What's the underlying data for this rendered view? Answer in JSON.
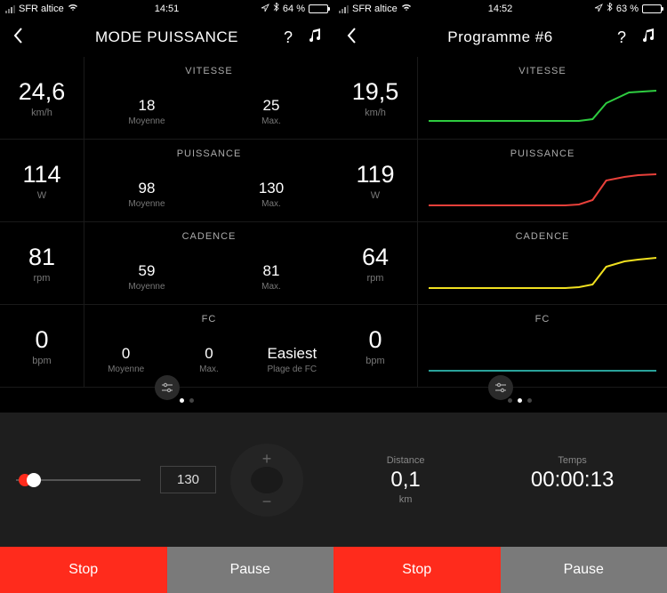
{
  "colors": {
    "stop": "#ff2b1c",
    "pause": "#7a7a7a",
    "vitesse": "#2ecc40",
    "puissance": "#e8403a",
    "cadence": "#f0e020",
    "fc": "#2aa39a"
  },
  "left": {
    "status": {
      "carrier": "SFR altice",
      "time": "14:51",
      "battery_pct": "64 %",
      "battery_fill": 64
    },
    "title": "MODE PUISSANCE",
    "metrics": {
      "vitesse": {
        "label": "VITESSE",
        "value": "24,6",
        "unit": "km/h",
        "moy": "18",
        "moy_l": "Moyenne",
        "max": "25",
        "max_l": "Max."
      },
      "puissance": {
        "label": "PUISSANCE",
        "value": "114",
        "unit": "W",
        "moy": "98",
        "moy_l": "Moyenne",
        "max": "130",
        "max_l": "Max."
      },
      "cadence": {
        "label": "CADENCE",
        "value": "81",
        "unit": "rpm",
        "moy": "59",
        "moy_l": "Moyenne",
        "max": "81",
        "max_l": "Max."
      },
      "fc": {
        "label": "FC",
        "value": "0",
        "unit": "bpm",
        "moy": "0",
        "moy_l": "Moyenne",
        "max": "0",
        "max_l": "Max.",
        "extra": "Easiest",
        "extra_l": "Plage de FC"
      }
    },
    "pager": {
      "active": 0,
      "count": 2
    },
    "control": {
      "value": "130",
      "plus": "+",
      "minus": "−"
    },
    "footer": {
      "stop": "Stop",
      "pause": "Pause"
    }
  },
  "right": {
    "status": {
      "carrier": "SFR altice",
      "time": "14:52",
      "battery_pct": "63 %",
      "battery_fill": 63
    },
    "title": "Programme #6",
    "metrics": {
      "vitesse": {
        "label": "VITESSE",
        "value": "19,5",
        "unit": "km/h"
      },
      "puissance": {
        "label": "PUISSANCE",
        "value": "119",
        "unit": "W"
      },
      "cadence": {
        "label": "CADENCE",
        "value": "64",
        "unit": "rpm"
      },
      "fc": {
        "label": "FC",
        "value": "0",
        "unit": "bpm"
      }
    },
    "pager": {
      "active": 1,
      "count": 3
    },
    "stats": {
      "distance_l": "Distance",
      "distance_v": "0,1",
      "distance_u": "km",
      "temps_l": "Temps",
      "temps_v": "00:00:13"
    },
    "footer": {
      "stop": "Stop",
      "pause": "Pause"
    }
  },
  "chart_data": [
    {
      "type": "line",
      "title": "VITESSE",
      "color": "#2ecc40",
      "x": [
        0,
        1,
        2,
        3,
        4,
        5,
        6,
        7,
        8,
        9
      ],
      "values": [
        12,
        12,
        12,
        12,
        12,
        12,
        13,
        18,
        19,
        19.5
      ],
      "ylim": [
        10,
        22
      ]
    },
    {
      "type": "line",
      "title": "PUISSANCE",
      "color": "#e8403a",
      "x": [
        0,
        1,
        2,
        3,
        4,
        5,
        6,
        7,
        8,
        9
      ],
      "values": [
        60,
        60,
        60,
        60,
        60,
        62,
        90,
        116,
        118,
        119
      ],
      "ylim": [
        50,
        130
      ]
    },
    {
      "type": "line",
      "title": "CADENCE",
      "color": "#f0e020",
      "x": [
        0,
        1,
        2,
        3,
        4,
        5,
        6,
        7,
        8,
        9
      ],
      "values": [
        40,
        40,
        40,
        40,
        40,
        41,
        55,
        62,
        63,
        64
      ],
      "ylim": [
        35,
        70
      ]
    },
    {
      "type": "line",
      "title": "FC",
      "color": "#2aa39a",
      "x": [
        0,
        1,
        2,
        3,
        4,
        5,
        6,
        7,
        8,
        9
      ],
      "values": [
        0,
        0,
        0,
        0,
        0,
        0,
        0,
        0,
        0,
        0
      ],
      "ylim": [
        0,
        1
      ]
    }
  ]
}
